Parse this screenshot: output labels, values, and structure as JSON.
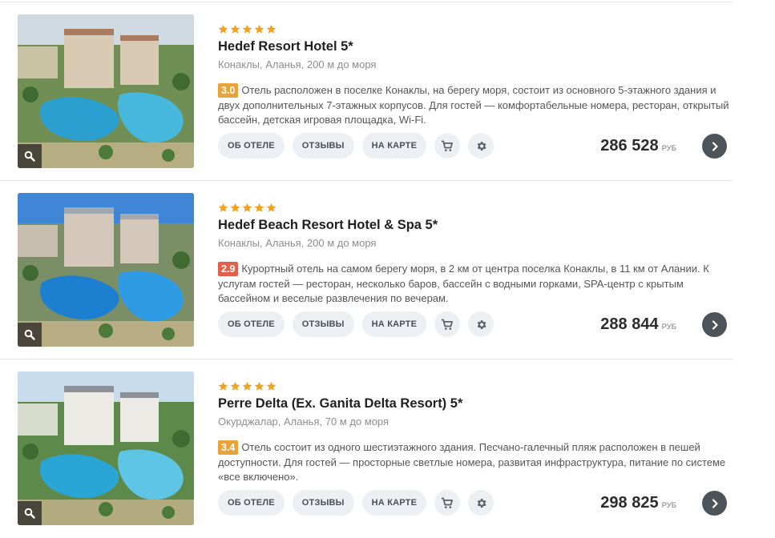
{
  "labels": {
    "about": "ОБ ОТЕЛЕ",
    "reviews": "ОТЗЫВЫ",
    "map": "НА КАРТЕ",
    "currency": "РУБ"
  },
  "colors": {
    "star": "#f2a01f",
    "rating_good": "#e8a33b",
    "rating_low": "#e2604a",
    "button_bg": "#edf0f3",
    "go_button": "#4d5459"
  },
  "icons": {
    "zoom": "magnifier-icon",
    "cart": "cart-icon",
    "settings": "gear-icon",
    "next": "chevron-right-icon"
  },
  "hotels": [
    {
      "stars": 5,
      "title": "Hedef Resort Hotel 5*",
      "location": "Конаклы, Аланья, 200 м до моря",
      "rating": "3.0",
      "rating_color": "#e8a33b",
      "description": "Отель расположен в поселке Конаклы, на берегу моря, состоит из основного 5-этажного здания и двух дополнительных 7-этажных корпусов. Для гостей — комфортабельные номера, ресторан, открытый бассейн, детская игровая площадка, Wi-Fi.",
      "price": "286 528"
    },
    {
      "stars": 5,
      "title": "Hedef Beach Resort Hotel & Spa 5*",
      "location": "Конаклы, Аланья, 200 м до моря",
      "rating": "2.9",
      "rating_color": "#e2604a",
      "description": "Курортный отель на самом берегу моря, в 2 км от центра поселка Конаклы, в 11 км от Алании. К услугам гостей — ресторан, несколько баров, бассейн с водными горками, SPA-центр с крытым бассейном и веселые развлечения по вечерам.",
      "price": "288 844"
    },
    {
      "stars": 5,
      "title": "Perre Delta (Ex. Ganita Delta Resort) 5*",
      "location": "Окурджалар, Аланья, 70 м до моря",
      "rating": "3.4",
      "rating_color": "#e8a33b",
      "description": "Отель состоит из одного шестиэтажного здания. Песчано-галечный пляж расположен в пешей доступности. Для гостей — просторные светлые номера, развитая инфраструктура, питание по системе «все включено».",
      "price": "298 825"
    }
  ]
}
